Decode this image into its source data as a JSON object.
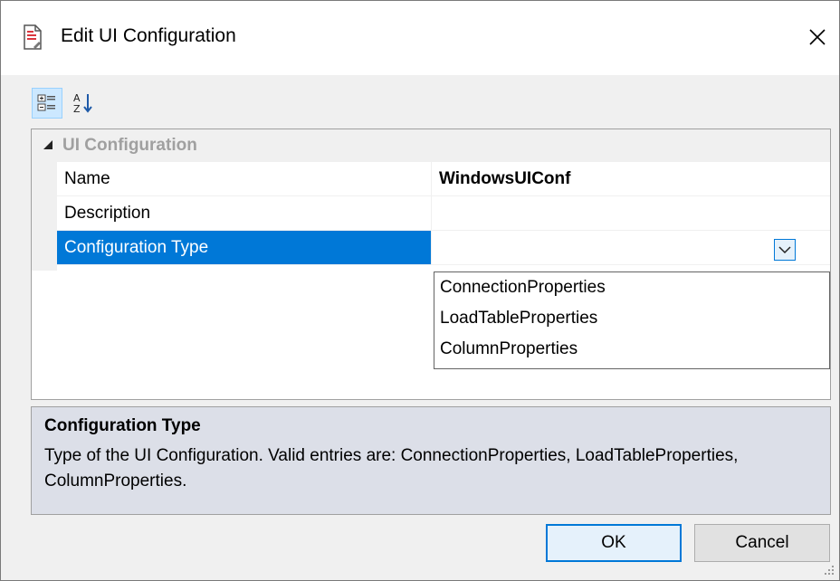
{
  "window": {
    "title": "Edit UI Configuration",
    "title_icon": "document-icon",
    "close_icon": "close-icon"
  },
  "toolbar": {
    "categorized_icon": "categorized-view-icon",
    "alphabetical_icon": "sort-alphabetical-icon"
  },
  "grid": {
    "category": "UI Configuration",
    "rows": [
      {
        "name": "Name",
        "value": "WindowsUIConf"
      },
      {
        "name": "Description",
        "value": ""
      },
      {
        "name": "Configuration Type",
        "value": ""
      }
    ],
    "dropdown_options": [
      "ConnectionProperties",
      "LoadTableProperties",
      "ColumnProperties"
    ]
  },
  "description": {
    "title": "Configuration Type",
    "text": "Type of the UI Configuration. Valid entries are: ConnectionProperties, LoadTableProperties, ColumnProperties."
  },
  "buttons": {
    "ok": "OK",
    "cancel": "Cancel"
  },
  "colors": {
    "selection": "#0078d7",
    "description_bg": "#dcdfe8",
    "category_text": "#a0a0a0"
  }
}
